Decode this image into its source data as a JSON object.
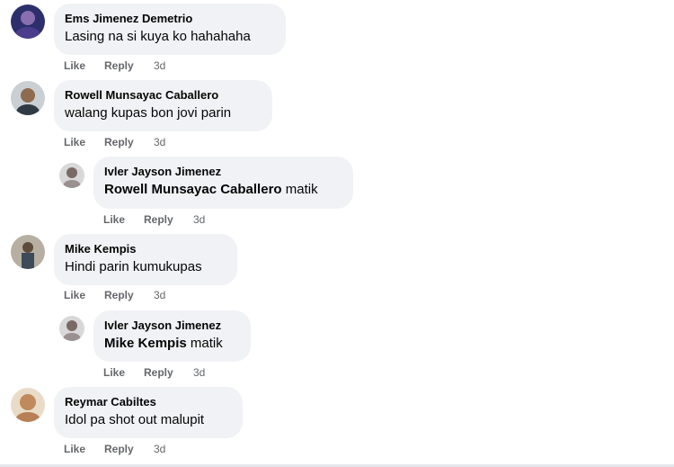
{
  "comments": [
    {
      "author": "Ems Jimenez Demetrio",
      "text": "Lasing na si kuya ko hahahaha",
      "like": "Like",
      "reply": "Reply",
      "time": "3d"
    },
    {
      "author": "Rowell Munsayac Caballero",
      "text": "walang kupas bon jovi parin",
      "like": "Like",
      "reply": "Reply",
      "time": "3d"
    },
    {
      "author": "Ivler Jayson Jimenez",
      "mention": "Rowell Munsayac Caballero",
      "text": " matik",
      "like": "Like",
      "reply": "Reply",
      "time": "3d"
    },
    {
      "author": "Mike Kempis",
      "text": "Hindi parin kumukupas",
      "like": "Like",
      "reply": "Reply",
      "time": "3d"
    },
    {
      "author": "Ivler Jayson Jimenez",
      "mention": "Mike Kempis",
      "text": " matik",
      "like": "Like",
      "reply": "Reply",
      "time": "3d"
    },
    {
      "author": "Reymar Cabiltes",
      "text": "Idol pa shot out malupit",
      "like": "Like",
      "reply": "Reply",
      "time": "3d"
    }
  ],
  "icons": [
    "avatar-photo"
  ],
  "colors": {
    "bubble": "#f0f2f5",
    "secondary_text": "#65676b",
    "primary_text": "#050505"
  }
}
